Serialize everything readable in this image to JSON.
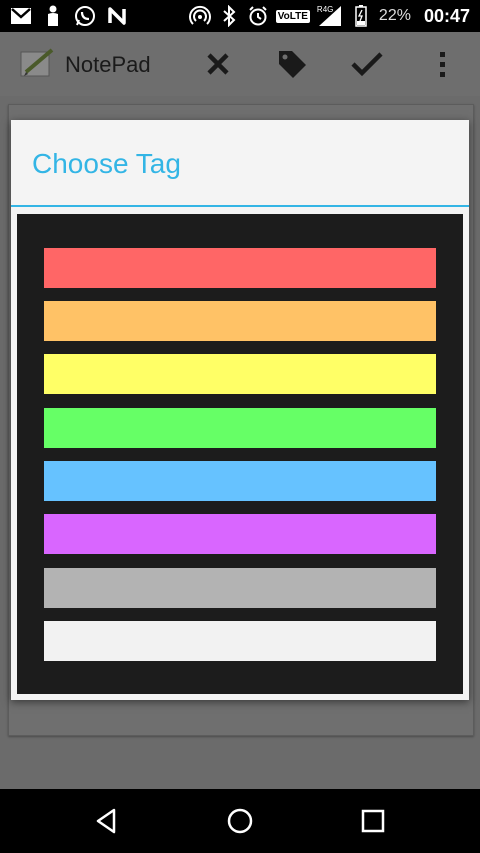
{
  "status_bar": {
    "lte_label": "VoLTE",
    "network_label": "R4G",
    "battery_percent": "22%",
    "time": "00:47",
    "left_icons": [
      "gmail-icon",
      "person-icon",
      "whatsapp-icon",
      "n-app-icon"
    ],
    "right_icons": [
      "hotspot-icon",
      "bluetooth-icon",
      "alarm-icon",
      "signal-icon",
      "battery-icon"
    ]
  },
  "action_bar": {
    "title": "NotePad",
    "actions": [
      "close-icon",
      "tag-icon",
      "check-icon",
      "overflow-menu-icon"
    ]
  },
  "dialog": {
    "title": "Choose Tag",
    "tags": [
      {
        "color": "#ff6666"
      },
      {
        "color": "#ffc266"
      },
      {
        "color": "#ffff66"
      },
      {
        "color": "#66ff66"
      },
      {
        "color": "#66c2ff"
      },
      {
        "color": "#d966ff"
      },
      {
        "color": "#b3b3b3"
      },
      {
        "color": "#f2f2f2"
      }
    ]
  },
  "colors": {
    "accent": "#33b5e5",
    "panel": "#1c1c1c"
  },
  "nav_bar": {
    "buttons": [
      "back-icon",
      "home-icon",
      "recents-icon"
    ]
  }
}
